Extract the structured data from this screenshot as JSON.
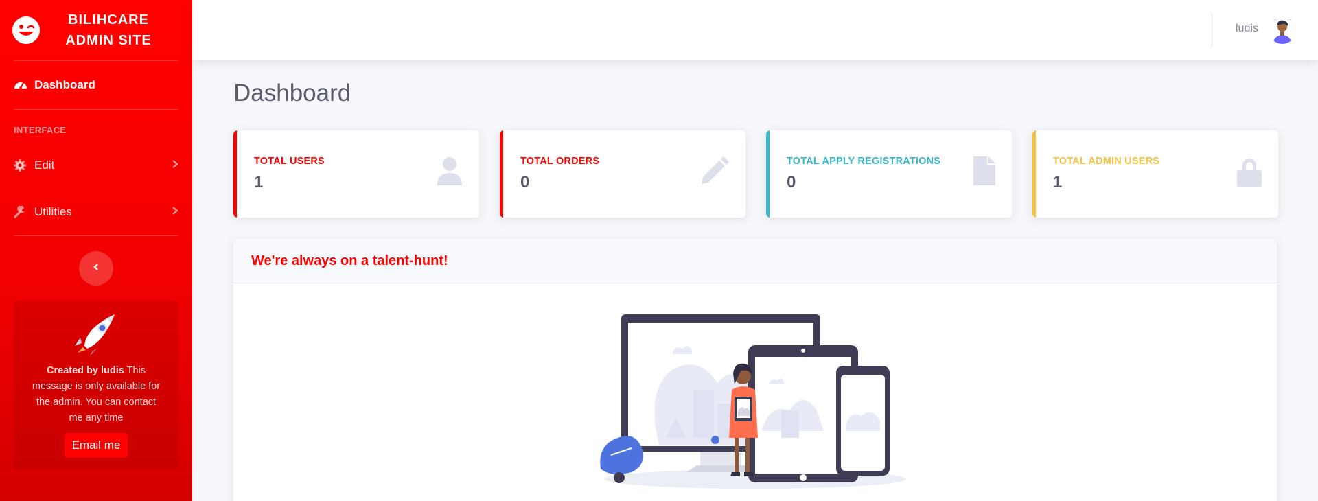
{
  "brand": {
    "line1": "BILIHCARE",
    "line2": "ADMIN SITE",
    "icon": "grin-wink-icon"
  },
  "sidebar": {
    "dashboard_label": "Dashboard",
    "heading": "INTERFACE",
    "items": [
      {
        "label": "Edit",
        "icon": "cog-icon"
      },
      {
        "label": "Utilities",
        "icon": "wrench-icon"
      }
    ],
    "promo": {
      "creator": "Created by ludis",
      "message": "This message is only available for the admin. You can contact me any time",
      "button": "Email me"
    }
  },
  "topbar": {
    "user_name": "ludis"
  },
  "page": {
    "title": "Dashboard"
  },
  "stats": [
    {
      "label": "TOTAL USERS",
      "value": "1",
      "color": "#ff0000",
      "icon": "user-icon"
    },
    {
      "label": "TOTAL ORDERS",
      "value": "0",
      "color": "#ff0000",
      "icon": "pencil-icon"
    },
    {
      "label": "TOTAL APPLY REGISTRATIONS",
      "value": "0",
      "color": "#36b9cc",
      "icon": "file-icon"
    },
    {
      "label": "TOTAL ADMIN USERS",
      "value": "1",
      "color": "#f6c23e",
      "icon": "lock-icon"
    }
  ],
  "talent": {
    "title": "We're always on a talent-hunt!"
  }
}
